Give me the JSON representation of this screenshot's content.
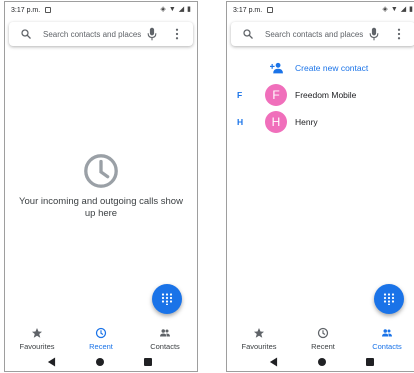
{
  "colors": {
    "accent": "#1a73e8",
    "avatar": "#f06fbb",
    "icon": "#5f6368"
  },
  "status_bar": {
    "time": "3:17 p.m."
  },
  "search": {
    "placeholder": "Search contacts and places"
  },
  "recent_screen": {
    "empty_message": "Your incoming and outgoing calls show up here"
  },
  "contacts_screen": {
    "create_label": "Create new contact",
    "contacts": [
      {
        "letter": "F",
        "initial": "F",
        "name": "Freedom Mobile"
      },
      {
        "letter": "H",
        "initial": "H",
        "name": "Henry"
      }
    ]
  },
  "nav": {
    "tabs": [
      {
        "label": "Favourites",
        "icon": "star-icon"
      },
      {
        "label": "Recent",
        "icon": "clock-icon"
      },
      {
        "label": "Contacts",
        "icon": "people-icon"
      }
    ],
    "left_active": "Recent",
    "right_active": "Contacts"
  }
}
